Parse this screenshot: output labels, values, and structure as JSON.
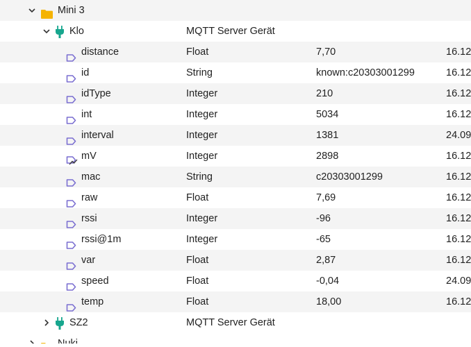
{
  "colors": {
    "folder": "#f5b301",
    "plug": "#17a68e",
    "state": "#7b6fd1",
    "chevron": "#333333"
  },
  "tree": {
    "mini3": {
      "label": "Mini 3",
      "icon": "folder-icon",
      "expanded": true
    },
    "klo": {
      "label": "Klo",
      "type": "MQTT Server Gerät",
      "icon": "plug-icon",
      "expanded": true
    },
    "states": [
      {
        "name": "distance",
        "type": "Float",
        "value": "7,70",
        "date": "16.12",
        "icon": "tag-icon"
      },
      {
        "name": "id",
        "type": "String",
        "value": "known:c20303001299",
        "date": "16.12",
        "icon": "tag-icon"
      },
      {
        "name": "idType",
        "type": "Integer",
        "value": "210",
        "date": "16.12",
        "icon": "tag-icon"
      },
      {
        "name": "int",
        "type": "Integer",
        "value": "5034",
        "date": "16.12",
        "icon": "tag-icon"
      },
      {
        "name": "interval",
        "type": "Integer",
        "value": "1381",
        "date": "24.09",
        "icon": "tag-icon"
      },
      {
        "name": "mV",
        "type": "Integer",
        "value": "2898",
        "date": "16.12",
        "icon": "tag-chart-icon"
      },
      {
        "name": "mac",
        "type": "String",
        "value": "c20303001299",
        "date": "16.12",
        "icon": "tag-icon"
      },
      {
        "name": "raw",
        "type": "Float",
        "value": "7,69",
        "date": "16.12",
        "icon": "tag-icon"
      },
      {
        "name": "rssi",
        "type": "Integer",
        "value": "-96",
        "date": "16.12",
        "icon": "tag-icon"
      },
      {
        "name": "rssi@1m",
        "type": "Integer",
        "value": "-65",
        "date": "16.12",
        "icon": "tag-icon"
      },
      {
        "name": "var",
        "type": "Float",
        "value": "2,87",
        "date": "16.12",
        "icon": "tag-icon"
      },
      {
        "name": "speed",
        "type": "Float",
        "value": "-0,04",
        "date": "24.09",
        "icon": "tag-icon"
      },
      {
        "name": "temp",
        "type": "Float",
        "value": "18,00",
        "date": "16.12",
        "icon": "tag-icon"
      }
    ],
    "sz2": {
      "label": "SZ2",
      "type": "MQTT Server Gerät",
      "icon": "plug-icon",
      "expanded": false
    },
    "nuki": {
      "label": "Nuki",
      "icon": "folder-icon",
      "expanded": false
    }
  }
}
